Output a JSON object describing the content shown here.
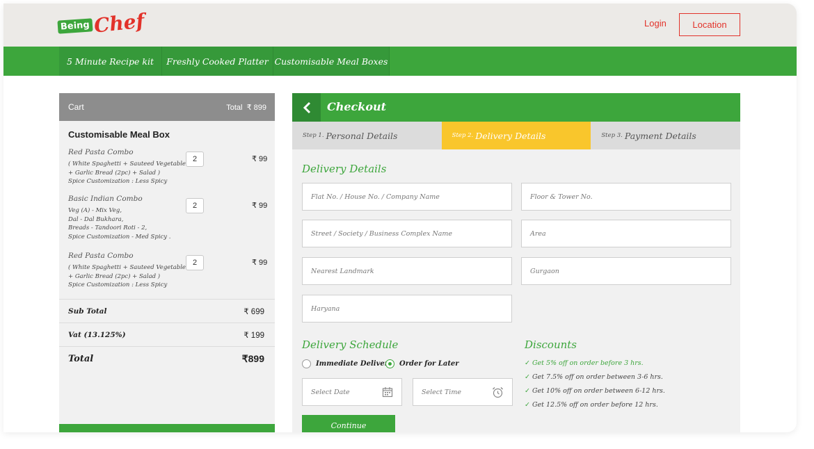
{
  "header": {
    "logo_being": "Being",
    "logo_chef": "Chef",
    "login": "Login",
    "location": "Location"
  },
  "nav": [
    {
      "label": "5 Minute Recipe kit"
    },
    {
      "label": "Freshly Cooked Platter"
    },
    {
      "label": "Customisable Meal Boxes"
    }
  ],
  "cart": {
    "title": "Cart",
    "total_label": "Total",
    "total_value": "₹ 899",
    "section": "Customisable Meal Box",
    "items": [
      {
        "name": "Red Pasta Combo",
        "desc": [
          "( White Spaghetti + Sauteed Vegetables",
          "+ Garlic Bread (2pc) + Salad )",
          "Spice Customization : Less Spicy"
        ],
        "qty": "2",
        "price": "₹ 99"
      },
      {
        "name": "Basic Indian Combo",
        "desc": [
          "Veg (A) - Mix Veg,",
          "Dal - Dal Bukhara,",
          "Breads - Tandoori Roti - 2,",
          "Spice Customization - Med Spicy ."
        ],
        "qty": "2",
        "price": "₹ 99"
      },
      {
        "name": "Red Pasta Combo",
        "desc": [
          "( White Spaghetti + Sauteed Vegetables",
          "+ Garlic Bread (2pc) + Salad )",
          "Spice Customization : Less Spicy"
        ],
        "qty": "2",
        "price": "₹ 99"
      }
    ],
    "subtotal_label": "Sub Total",
    "subtotal_value": "₹ 699",
    "vat_label": "Vat (13.125%)",
    "vat_value": "₹ 199",
    "grand_label": "Total",
    "grand_value": "₹899"
  },
  "checkout": {
    "title": "Checkout",
    "steps": [
      {
        "num": "Step 1.",
        "label": "Personal Details"
      },
      {
        "num": "Step 2.",
        "label": "Delivery Details"
      },
      {
        "num": "Step 3.",
        "label": "Payment Details"
      }
    ],
    "delivery_title": "Delivery Details",
    "fields": {
      "flat": "Flat No. / House No. / Company Name",
      "floor": "Floor & Tower No.",
      "street": "Street / Society / Business Complex Name",
      "area": "Area",
      "landmark": "Nearest Landmark",
      "city": "Gurgaon",
      "state": "Haryana"
    },
    "schedule_title": "Delivery Schedule",
    "radio_immediate": "Immediate Delivery",
    "radio_later": "Order for Later",
    "select_date": "Select Date",
    "select_time": "Select Time",
    "discounts_title": "Discounts",
    "discounts": [
      "Get 5% off on order before 3 hrs.",
      "Get 7.5% off on order between 3-6 hrs.",
      "Get 10% off on order between 6-12 hrs.",
      "Get 12.5% off on order before 12 hrs."
    ],
    "continue": "Continue"
  },
  "colors": {
    "brand_green": "#3da63c",
    "brand_red": "#e2322a",
    "step_active": "#f9c62c"
  },
  "icons": [
    "chevron-left-icon",
    "calendar-icon",
    "alarm-clock-icon",
    "check-icon"
  ]
}
